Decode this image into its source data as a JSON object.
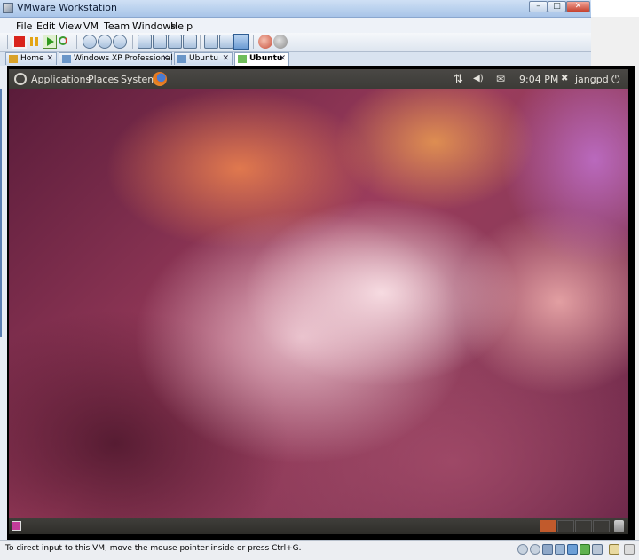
{
  "window": {
    "title": "VMware Workstation",
    "min_label": "–",
    "max_label": "□",
    "close_label": "✕"
  },
  "menu": [
    "File",
    "Edit",
    "View",
    "VM",
    "Team",
    "Windows",
    "Help"
  ],
  "tabs": [
    {
      "label": "Home",
      "close": "✕"
    },
    {
      "label": "Windows XP Professional",
      "close": "✕"
    },
    {
      "label": "Ubuntu",
      "close": "✕"
    },
    {
      "label": "Ubuntu",
      "close": "✕",
      "active": true
    }
  ],
  "gnome": {
    "applications": "Applications",
    "places": "Places",
    "system": "System",
    "clock": "9:04 PM",
    "user": "jangpd",
    "network_icon": "⇅",
    "volume_icon": "◀)",
    "mail_icon": "✉",
    "power_icon": "⏻",
    "user_icon": "✖"
  },
  "status": {
    "message": "To direct input to this VM, move the mouse pointer inside or press Ctrl+G."
  },
  "colors": {
    "panel": "#3c3b37",
    "workspace_active": "#c15a2c"
  }
}
